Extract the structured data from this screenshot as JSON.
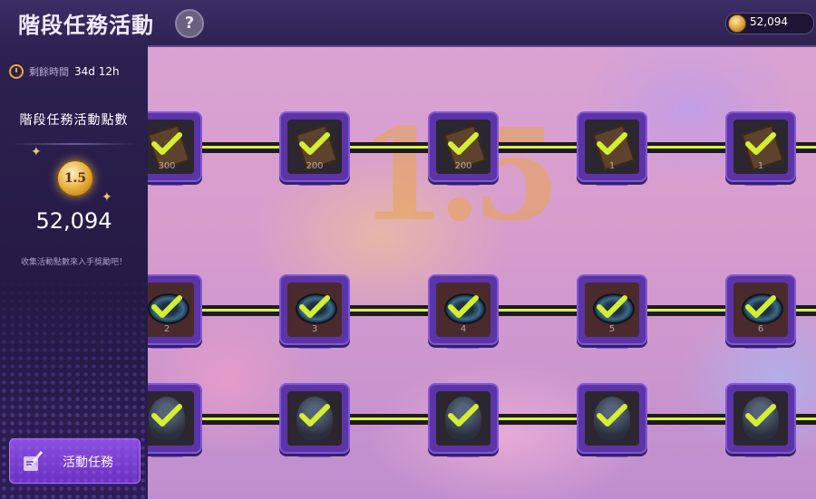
{
  "header": {
    "title": "階段任務活動",
    "help_label": "?",
    "currency_value": "52,094"
  },
  "sidebar": {
    "timer_label": "剩餘時間",
    "timer_value": "34d 12h",
    "points_title": "階段任務活動點數",
    "coin_label": "1.5",
    "points_value": "52,094",
    "hint": "收集活動點數來入手獎勵吧！",
    "task_button_label": "活動任務"
  },
  "rows": [
    {
      "nodes": [
        {
          "item": "ticket",
          "qty": "300",
          "claimed": true
        },
        {
          "item": "ticket",
          "qty": "200",
          "claimed": true
        },
        {
          "item": "ticket",
          "qty": "200",
          "claimed": true
        },
        {
          "item": "ticket",
          "qty": "1",
          "claimed": true
        },
        {
          "item": "ticket",
          "qty": "1",
          "claimed": true
        }
      ]
    },
    {
      "nodes": [
        {
          "item": "ring",
          "qty": "2",
          "claimed": true
        },
        {
          "item": "ring",
          "qty": "3",
          "claimed": true
        },
        {
          "item": "ring",
          "qty": "4",
          "claimed": true
        },
        {
          "item": "ring",
          "qty": "5",
          "claimed": true
        },
        {
          "item": "ring",
          "qty": "6",
          "claimed": true
        }
      ]
    },
    {
      "nodes": [
        {
          "item": "hero",
          "qty": "",
          "claimed": true
        },
        {
          "item": "hero",
          "qty": "",
          "claimed": true
        },
        {
          "item": "hero",
          "qty": "",
          "claimed": true
        },
        {
          "item": "hero",
          "qty": "",
          "claimed": true
        },
        {
          "item": "hero",
          "qty": "",
          "claimed": true
        }
      ]
    }
  ],
  "colors": {
    "accent": "#8a4de0",
    "rail": "#d8f23a",
    "check": "#d4ef2f"
  }
}
